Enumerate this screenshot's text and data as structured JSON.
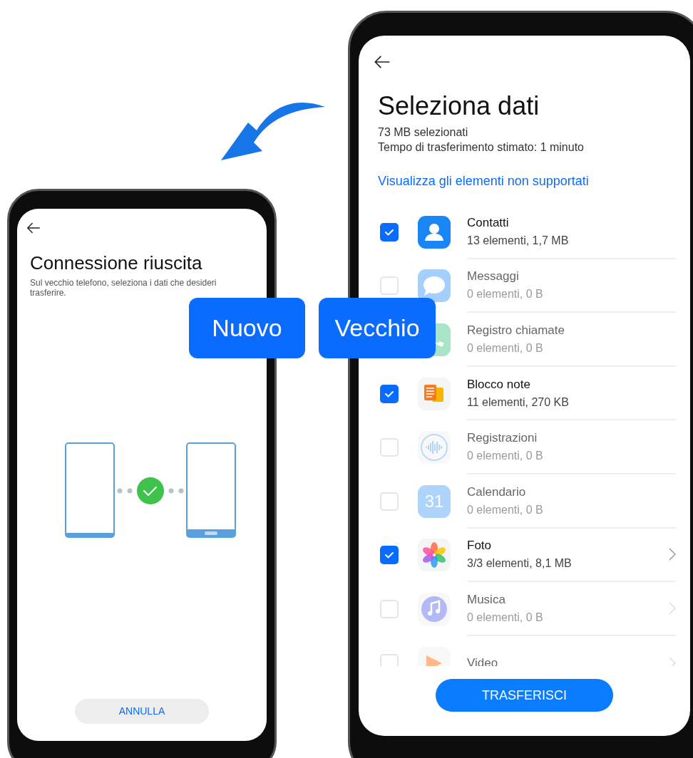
{
  "new_phone": {
    "label": "Nuovo",
    "title": "Connessione riuscita",
    "subtitle": "Sul vecchio telefono, seleziona i dati che desideri trasferire.",
    "cancel_button": "ANNULLA"
  },
  "old_phone": {
    "label": "Vecchio",
    "title": "Seleziona dati",
    "selected_size": "73 MB selezionati",
    "estimated_time": "Tempo di trasferimento stimato: 1 minuto",
    "unsupported_link": "Visualizza gli elementi non supportati",
    "items": [
      {
        "name": "Contatti",
        "detail": "13 elementi, 1,7 MB",
        "checked": true,
        "has_details": false
      },
      {
        "name": "Messaggi",
        "detail": "0 elementi, 0 B",
        "checked": false,
        "has_details": false
      },
      {
        "name": "Registro chiamate",
        "detail": "0 elementi, 0 B",
        "has_details": false
      },
      {
        "name": "Blocco note",
        "detail": "11 elementi, 270 KB",
        "checked": true,
        "has_details": false
      },
      {
        "name": "Registrazioni",
        "detail": "0 elementi, 0 B",
        "checked": false,
        "has_details": false
      },
      {
        "name": "Calendario",
        "detail": "0 elementi, 0 B",
        "checked": false,
        "has_details": false,
        "icon_label": "31"
      },
      {
        "name": "Foto",
        "detail": "3/3 elementi, 8,1 MB",
        "checked": true,
        "has_details": true
      },
      {
        "name": "Musica",
        "detail": "0 elementi, 0 B",
        "checked": false,
        "has_details": true
      },
      {
        "name": "Video",
        "checked": false,
        "has_details": true
      }
    ],
    "transfer_button": "TRASFERISCI"
  }
}
